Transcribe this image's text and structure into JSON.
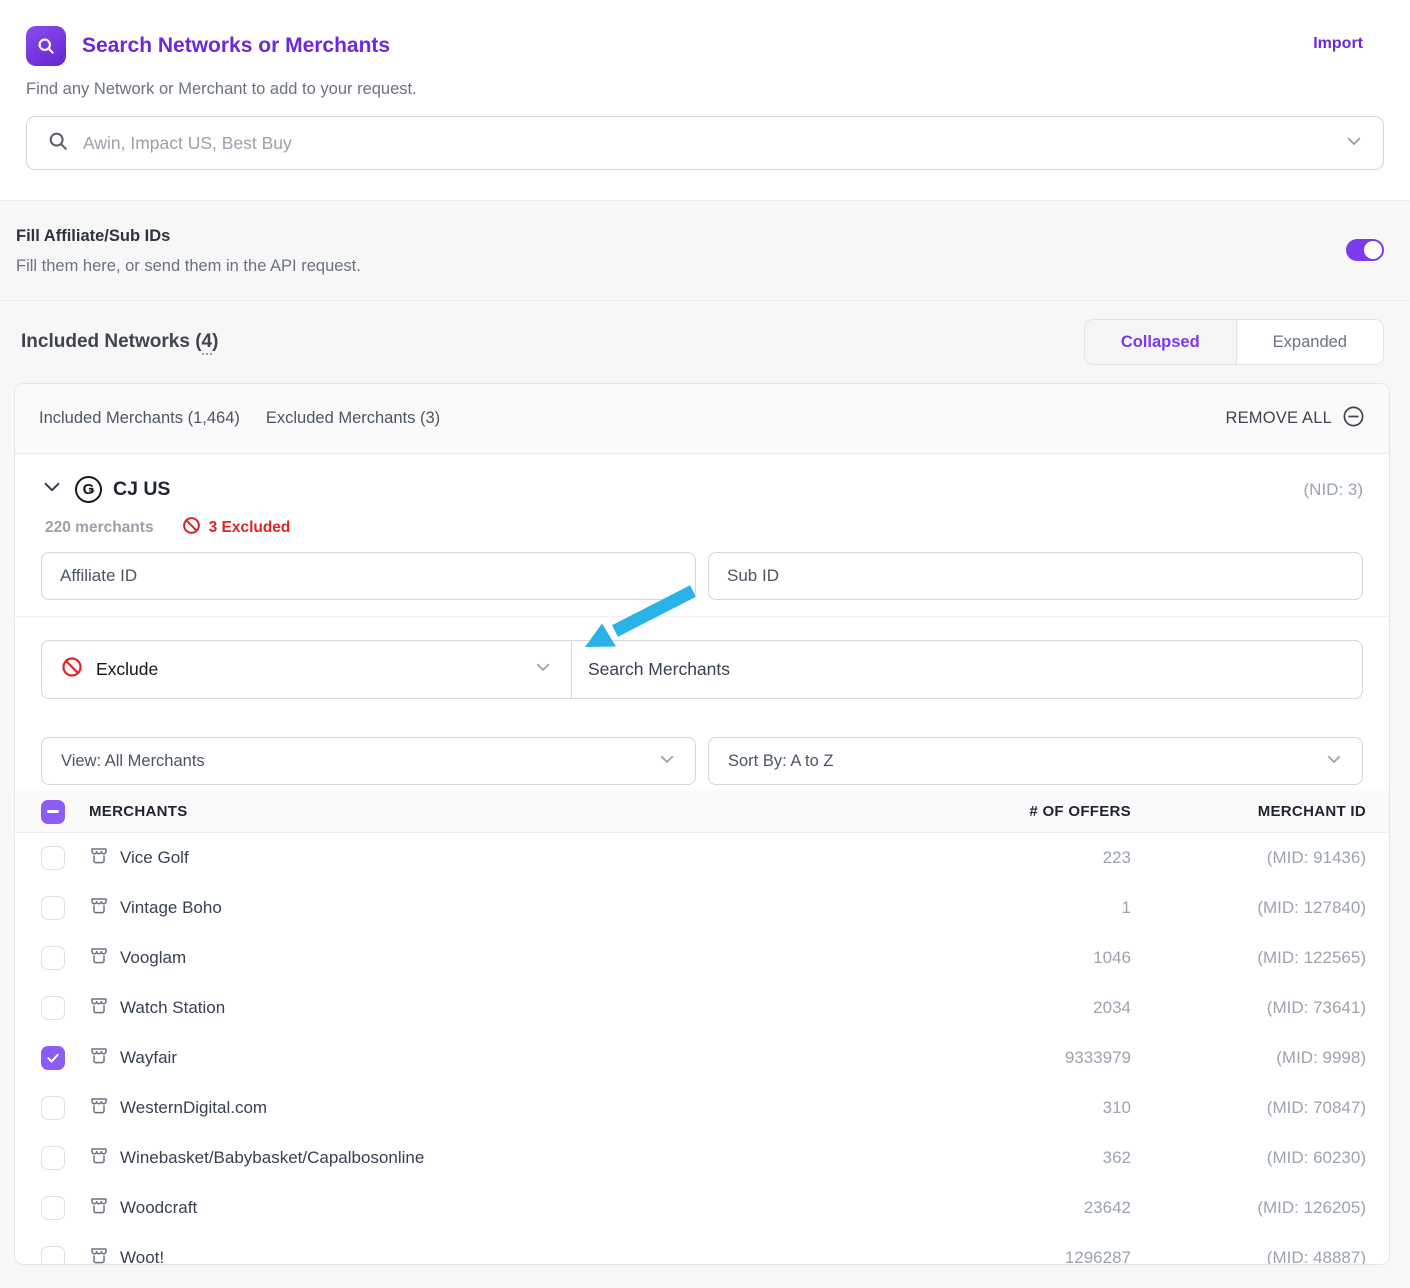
{
  "header": {
    "title": "Search Networks or Merchants",
    "subtitle": "Find any Network or Merchant to add to your request.",
    "import_label": "Import",
    "search_placeholder": "Awin, Impact US, Best Buy"
  },
  "fill_ids": {
    "title": "Fill Affiliate/Sub IDs",
    "subtitle": "Fill them here, or send them in the API request.",
    "toggle_state": "on"
  },
  "networks": {
    "label_prefix": "Included Networks (",
    "count": "4",
    "label_suffix": ")",
    "view_collapsed": "Collapsed",
    "view_expanded": "Expanded"
  },
  "card": {
    "included_tab": "Included Merchants (1,464)",
    "excluded_tab": "Excluded Merchants (3)",
    "remove_all": "REMOVE ALL",
    "network": {
      "logo_glyph": "Ǥ",
      "name": "CJ US",
      "nid": "(NID: 3)",
      "merchants_count": "220 merchants",
      "excluded": "3 Excluded",
      "affiliate_id_placeholder": "Affiliate ID",
      "sub_id_placeholder": "Sub ID",
      "exclude_action": "Exclude",
      "search_merchants_placeholder": "Search Merchants",
      "view_filter": "View: All Merchants",
      "sort_filter": "Sort By: A to Z"
    },
    "table": {
      "columns": [
        "MERCHANTS",
        "# OF OFFERS",
        "MERCHANT ID"
      ],
      "rows": [
        {
          "name": "Vice Golf",
          "offers": "223",
          "mid": "(MID: 91436)",
          "checked": false
        },
        {
          "name": "Vintage Boho",
          "offers": "1",
          "mid": "(MID: 127840)",
          "checked": false
        },
        {
          "name": "Vooglam",
          "offers": "1046",
          "mid": "(MID: 122565)",
          "checked": false
        },
        {
          "name": "Watch Station",
          "offers": "2034",
          "mid": "(MID: 73641)",
          "checked": false
        },
        {
          "name": "Wayfair",
          "offers": "9333979",
          "mid": "(MID: 9998)",
          "checked": true
        },
        {
          "name": "WesternDigital.com",
          "offers": "310",
          "mid": "(MID: 70847)",
          "checked": false
        },
        {
          "name": "Winebasket/Babybasket/Capalbosonline",
          "offers": "362",
          "mid": "(MID: 60230)",
          "checked": false
        },
        {
          "name": "Woodcraft",
          "offers": "23642",
          "mid": "(MID: 126205)",
          "checked": false
        },
        {
          "name": "Woot!",
          "offers": "1296287",
          "mid": "(MID: 48887)",
          "checked": false
        }
      ]
    }
  },
  "colors": {
    "accent_purple": "#6d28d9",
    "checkbox_purple": "#8b5cf6",
    "danger_red": "#e02424",
    "arrow_blue": "#29b2e8"
  }
}
